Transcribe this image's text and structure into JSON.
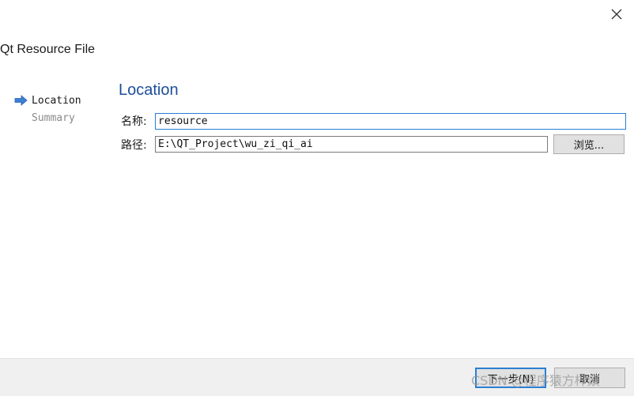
{
  "window": {
    "close_glyph": "✕"
  },
  "wizard": {
    "title": "Qt Resource File",
    "steps": [
      {
        "label": "Location",
        "state": "current",
        "icon": "arrow-right-icon"
      },
      {
        "label": "Summary",
        "state": "pending"
      }
    ]
  },
  "page": {
    "heading": "Location",
    "name_label": "名称:",
    "name_value": "resource",
    "path_label": "路径:",
    "path_value": "E:\\QT_Project\\wu_zi_qi_ai",
    "browse_label": "浏览..."
  },
  "footer": {
    "next_label": "下一步(N)",
    "cancel_label": "取消"
  },
  "watermark": {
    "text": "CSDN @程序猿方梓燚"
  },
  "colors": {
    "accent": "#1d4e9a",
    "focus_border": "#2a7fd4",
    "arrow_icon": "#3d7fd6"
  }
}
